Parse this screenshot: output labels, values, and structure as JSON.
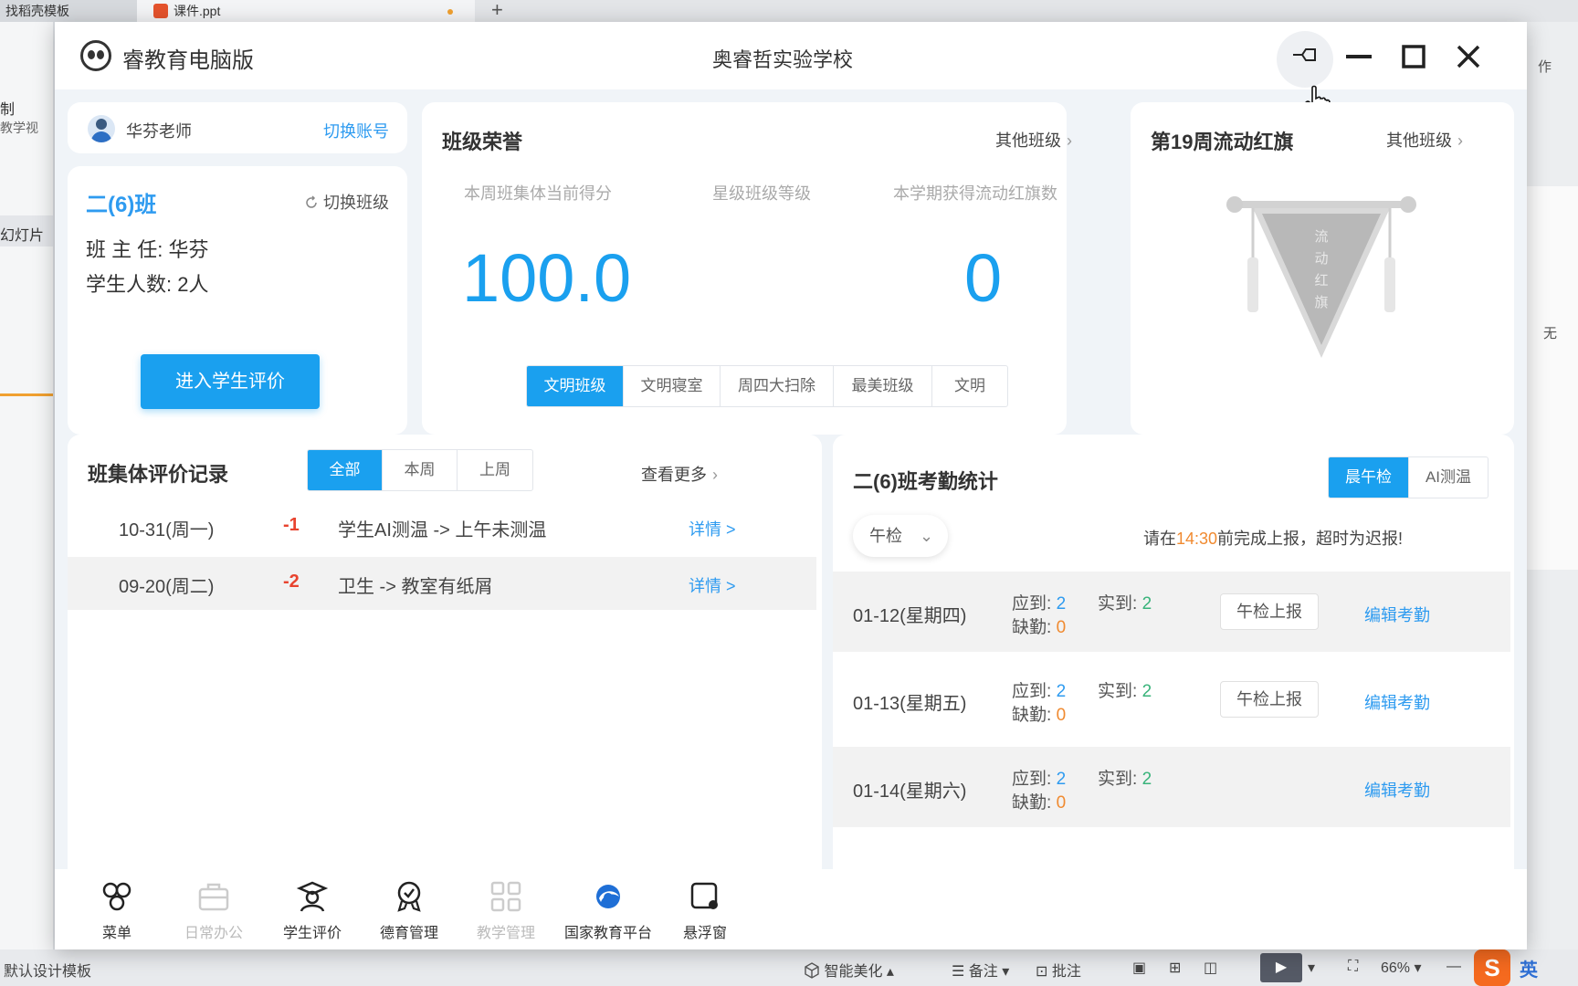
{
  "host": {
    "tabs": [
      "找稻壳模板",
      "课件.ppt"
    ],
    "left_texts": [
      "制",
      "教学视",
      "幻灯片"
    ],
    "right_texts": [
      "作",
      "无"
    ],
    "status": {
      "template": "默认设计模板",
      "beautify": "智能美化",
      "notes": "备注",
      "comments": "批注",
      "zoom": "66%",
      "ime": "英"
    }
  },
  "window": {
    "app_name": "睿教育电脑版",
    "school_name": "奥睿哲实验学校"
  },
  "user": {
    "name": "华芬老师",
    "switch_account": "切换账号"
  },
  "class_info": {
    "name": "二(6)班",
    "switch_class": "切换班级",
    "teacher_label": "班 主 任:",
    "teacher": "华芬",
    "students_label": "学生人数:",
    "students": "2人",
    "enter_button": "进入学生评价"
  },
  "honor": {
    "title": "班级荣誉",
    "other_classes": "其他班级",
    "labels": [
      "本周班集体当前得分",
      "星级班级等级",
      "本学期获得流动红旗数"
    ],
    "score": "100.0",
    "flags": "0",
    "tabs": [
      "文明班级",
      "文明寝室",
      "周四大扫除",
      "最美班级",
      "文明"
    ],
    "active_tab": 0
  },
  "red_flag": {
    "title": "第19周流动红旗",
    "other_classes": "其他班级",
    "flag_text": [
      "流",
      "动",
      "红",
      "旗"
    ]
  },
  "records": {
    "title": "班集体评价记录",
    "tabs": [
      "全部",
      "本周",
      "上周"
    ],
    "active_tab": 0,
    "more": "查看更多",
    "rows": [
      {
        "date": "10-31(周一)",
        "score": "-1",
        "desc": "学生AI测温 -> 上午未测温",
        "detail": "详情 >"
      },
      {
        "date": "09-20(周二)",
        "score": "-2",
        "desc": "卫生 -> 教室有纸屑",
        "detail": "详情 >"
      }
    ]
  },
  "attendance": {
    "title": "二(6)班考勤统计",
    "tabs": [
      "晨午检",
      "AI测温"
    ],
    "active_tab": 0,
    "filter": "午检",
    "notice_prefix": "请在",
    "notice_time": "14:30",
    "notice_suffix": "前完成上报，超时为迟报!",
    "due_label": "应到:",
    "actual_label": "实到:",
    "absent_label": "缺勤:",
    "report_label": "午检上报",
    "edit_label": "编辑考勤",
    "rows": [
      {
        "date": "01-12(星期四)",
        "due": "2",
        "actual": "2",
        "absent": "0",
        "has_report": true
      },
      {
        "date": "01-13(星期五)",
        "due": "2",
        "actual": "2",
        "absent": "0",
        "has_report": true
      },
      {
        "date": "01-14(星期六)",
        "due": "2",
        "actual": "2",
        "absent": "0",
        "has_report": false
      }
    ]
  },
  "dock": [
    {
      "label": "菜单",
      "icon": "menu-icon",
      "dim": false
    },
    {
      "label": "日常办公",
      "icon": "briefcase-icon",
      "dim": true
    },
    {
      "label": "学生评价",
      "icon": "student-icon",
      "dim": false
    },
    {
      "label": "德育管理",
      "icon": "medal-icon",
      "dim": false
    },
    {
      "label": "教学管理",
      "icon": "grid-icon",
      "dim": true
    },
    {
      "label": "国家教育平台",
      "icon": "platform-icon",
      "dim": false
    },
    {
      "label": "悬浮窗",
      "icon": "float-window-icon",
      "dim": false
    }
  ],
  "colors": {
    "accent": "#1aa0ef",
    "negative": "#e8432e",
    "positive": "#38b37a",
    "warning": "#f08a30"
  }
}
